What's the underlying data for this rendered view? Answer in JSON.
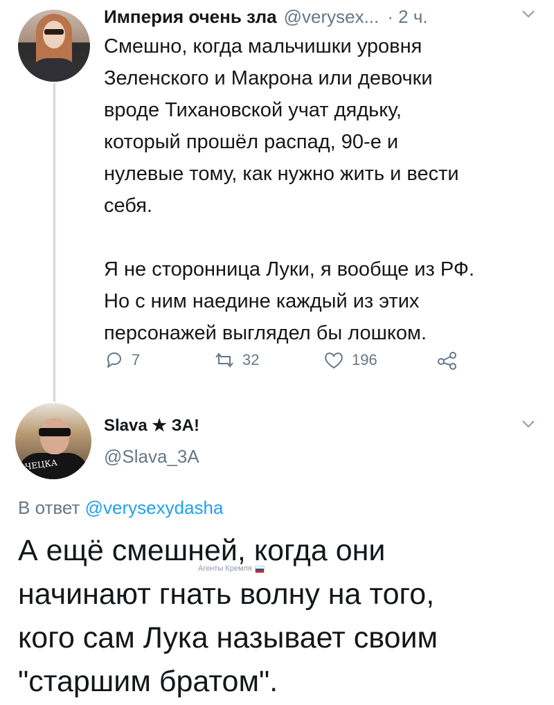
{
  "tweet1": {
    "display_name": "Империя очень зла",
    "handle": "@verysex...",
    "time": "· 2 ч.",
    "paragraph1": [
      "Смешно, когда мальчишки уровня",
      "Зеленского и Макрона или девочки",
      "вроде Тихановской учат дядьку,",
      "который прошёл распад, 90-е и",
      "нулевые тому, как нужно жить и вести",
      "себя."
    ],
    "paragraph2": [
      "Я не сторонница Луки, я вообще из РФ.",
      "Но с ним наедине каждый из этих",
      "персонажей выглядел бы лошком."
    ],
    "actions": {
      "reply_count": "7",
      "retweet_count": "32",
      "like_count": "196"
    }
  },
  "tweet2": {
    "display_name": "Slava ★ ЗА!",
    "handle": "@Slava_3A",
    "avatar_shirt_text": "ЧЕЦКА",
    "reply_prefix": "В ответ",
    "reply_mention": "@verysexydasha",
    "body": [
      "А ещё смешней, когда они",
      "начинают гнать волну на того,",
      "кого сам Лука называет своим",
      "\"старшим братом\"."
    ]
  },
  "watermark": {
    "text": "Агенты Кремля"
  },
  "colors": {
    "text": "#14171a",
    "secondary": "#657786",
    "link": "#1da1f2",
    "thread_line": "#cfd9de"
  },
  "icons": [
    "reply-icon",
    "retweet-icon",
    "like-icon",
    "share-icon",
    "chevron-down-icon"
  ]
}
